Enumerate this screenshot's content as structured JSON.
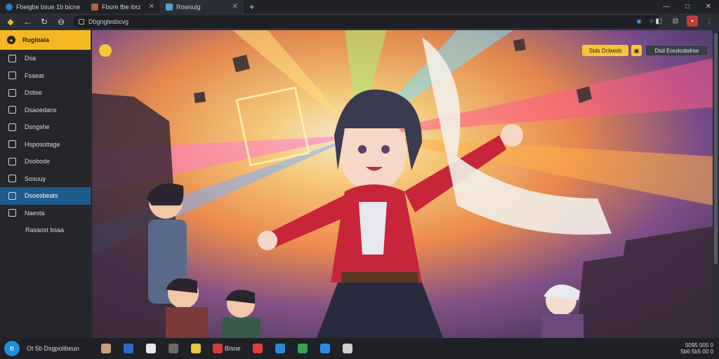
{
  "tabs": [
    {
      "label": "Fbeigbe bsue 1b bicne",
      "favicon": "#3a7bd5",
      "active": false
    },
    {
      "label": "Fbure fbe ibrz",
      "favicon": "#c46a3a",
      "active": false
    },
    {
      "label": "Rowsulg",
      "favicon": "#5aa0d8",
      "active": true
    }
  ],
  "new_tab": "+",
  "window_controls": [
    "—",
    "□",
    "✕"
  ],
  "toolbar": {
    "back": "←",
    "forward": "→",
    "reload": "↻",
    "url": "Dbgnglesbcvg"
  },
  "sidebar": {
    "header": "Rugloaia",
    "items": [
      {
        "label": "Dsa",
        "icon": "square-icon",
        "active": false
      },
      {
        "label": "Fsaeat",
        "icon": "square-icon",
        "active": false
      },
      {
        "label": "Dstise",
        "icon": "list-icon",
        "active": false
      },
      {
        "label": "Dsaoedans",
        "icon": "grid-icon",
        "active": false
      },
      {
        "label": "Dsngshe",
        "icon": "tag-icon",
        "active": false
      },
      {
        "label": "Hsposottage",
        "icon": "gear-icon",
        "active": false
      },
      {
        "label": "Dsobode",
        "icon": "page-icon",
        "active": false
      },
      {
        "label": "Sosuuy",
        "icon": "square-icon",
        "active": false
      },
      {
        "label": "Dsoesbeats",
        "icon": "panel-icon",
        "active": true
      },
      {
        "label": "Naesta",
        "icon": "globe-icon",
        "active": false
      },
      {
        "label": "Rasaost bsaa",
        "icon": "",
        "active": false
      }
    ]
  },
  "content": {
    "badge": "⚡",
    "btn_primary": "Stds Dcbwsb",
    "btn_square": "▣",
    "btn_secondary": "Dsd Eocdcsbdrse"
  },
  "taskbar": {
    "start": "e",
    "search": "Ot 5b Dsgpolibeun",
    "apps": [
      "",
      "",
      "",
      "",
      "",
      "Bisne",
      "",
      "",
      "",
      "",
      ""
    ],
    "tray_time": "5095 005 0",
    "tray_date": "5b6 5b5 00 0"
  },
  "colors": {
    "accent": "#f5b821",
    "active_item": "#1e5a8c",
    "chrome": "#2b2e35"
  }
}
